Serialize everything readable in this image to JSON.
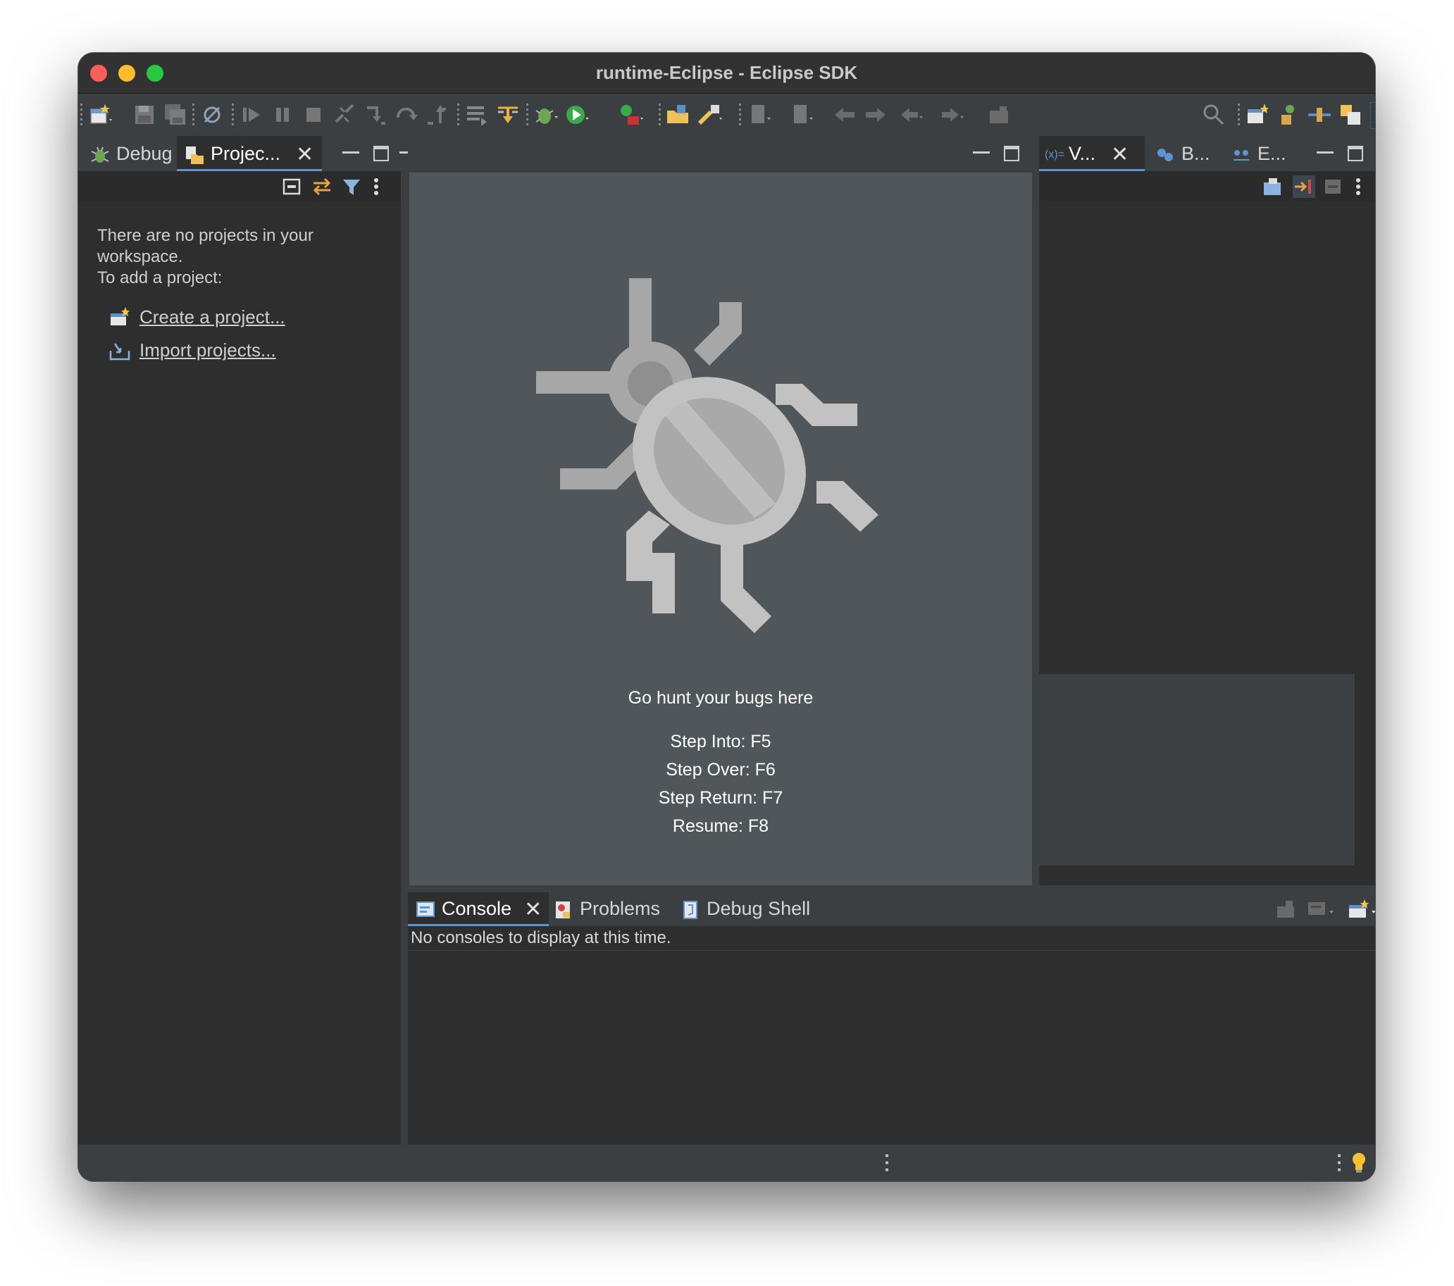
{
  "window": {
    "title": "runtime-Eclipse - Eclipse SDK"
  },
  "toolbar": {
    "icons": [
      "new-wizard-icon",
      "save-icon",
      "save-all-icon",
      "skip-breakpoints-icon",
      "resume-icon",
      "suspend-icon",
      "terminate-icon",
      "disconnect-icon",
      "step-into-icon",
      "step-over-icon",
      "step-return-icon",
      "drop-to-frame-icon",
      "use-step-filters-icon",
      "debug-icon",
      "run-icon",
      "external-tools-icon",
      "open-type-icon",
      "search-icon",
      "open-perspective-icon",
      "java-perspective-icon",
      "debug-perspective-icon"
    ]
  },
  "left_panel": {
    "tabs": [
      {
        "label": "Debug",
        "icon": "debug-bug-icon"
      },
      {
        "label": "Projec...",
        "icon": "project-explorer-icon"
      }
    ],
    "empty_message_line1": "There are no projects in your",
    "empty_message_line2": "workspace.",
    "empty_message_line3": "To add a project:",
    "create_link": "Create a project...",
    "import_link": "Import projects..."
  },
  "editor": {
    "headline": "Go hunt your bugs here",
    "shortcuts": [
      "Step Into: F5",
      "Step Over: F6",
      "Step Return: F7",
      "Resume: F8"
    ]
  },
  "right_panel": {
    "tabs": [
      {
        "label": "V...",
        "icon": "variables-icon",
        "prefix": "(x)="
      },
      {
        "label": "B...",
        "icon": "breakpoints-icon"
      },
      {
        "label": "E...",
        "icon": "expressions-icon"
      }
    ]
  },
  "console_panel": {
    "tabs": [
      {
        "label": "Console",
        "icon": "console-icon"
      },
      {
        "label": "Problems",
        "icon": "problems-icon"
      },
      {
        "label": "Debug Shell",
        "icon": "debug-shell-icon"
      }
    ],
    "message": "No consoles to display at this time."
  },
  "colors": {
    "window_bg": "#3c3f41",
    "content_bg": "#2e2e2e",
    "editor_bg": "#50565a",
    "active_tab_underline": "#5e95cf"
  }
}
